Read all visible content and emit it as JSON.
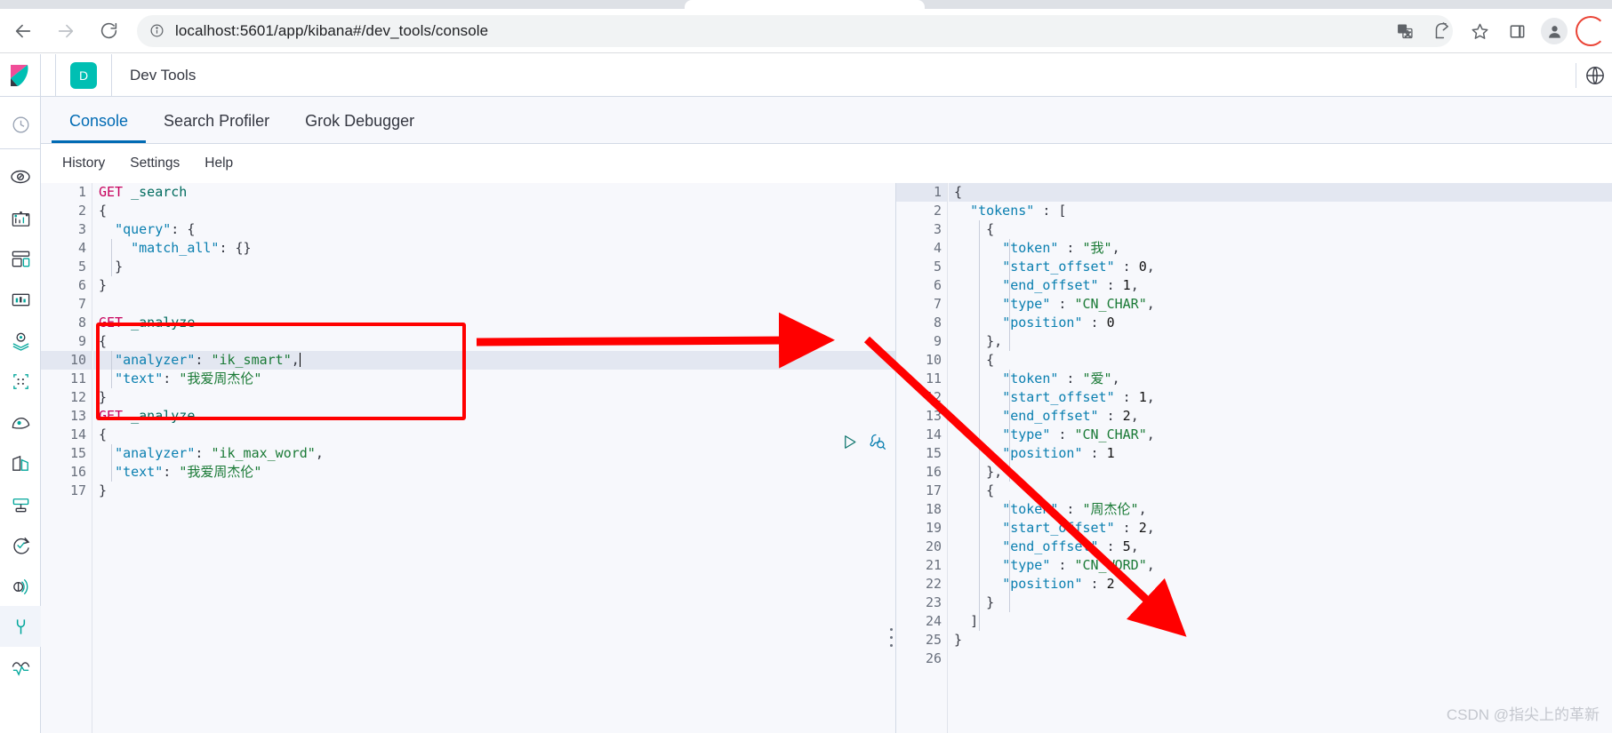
{
  "browser": {
    "url": "localhost:5601/app/kibana#/dev_tools/console",
    "back_label": "Back",
    "forward_label": "Forward",
    "reload_label": "Reload",
    "site_info_label": "View site information",
    "translate_label": "Translate this page",
    "share_label": "Share this page",
    "bookmark_label": "Bookmark this tab",
    "sidepanel_label": "Show side panel",
    "profile_label": "Profile"
  },
  "kibana": {
    "app_badge": "D",
    "app_title": "Dev Tools",
    "help_label": "Help menu",
    "tabs": [
      {
        "label": "Console",
        "active": true
      },
      {
        "label": "Search Profiler",
        "active": false
      },
      {
        "label": "Grok Debugger",
        "active": false
      }
    ],
    "console_menu": [
      {
        "label": "History"
      },
      {
        "label": "Settings"
      },
      {
        "label": "Help"
      }
    ],
    "sidebar": [
      {
        "name": "recently-viewed-icon"
      },
      {
        "name": "discover-icon"
      },
      {
        "name": "visualize-icon"
      },
      {
        "name": "dashboard-icon"
      },
      {
        "name": "canvas-icon"
      },
      {
        "name": "maps-icon"
      },
      {
        "name": "machine-learning-icon"
      },
      {
        "name": "infrastructure-icon"
      },
      {
        "name": "logs-icon"
      },
      {
        "name": "apm-icon"
      },
      {
        "name": "uptime-icon"
      },
      {
        "name": "siem-icon"
      },
      {
        "name": "dev-tools-icon"
      },
      {
        "name": "monitoring-icon"
      }
    ],
    "request_actions": {
      "play_label": "Click to send request",
      "wrench_label": "Open documentation / options"
    }
  },
  "editor": {
    "lines": [
      {
        "n": 1,
        "fold": "",
        "tokens": [
          {
            "t": "method",
            "v": "GET"
          },
          {
            "t": "plain",
            "v": " "
          },
          {
            "t": "url",
            "v": "_search"
          }
        ]
      },
      {
        "n": 2,
        "fold": "▾",
        "tokens": [
          {
            "t": "punct",
            "v": "{"
          }
        ]
      },
      {
        "n": 3,
        "fold": "▾",
        "tokens": [
          {
            "t": "plain",
            "v": "  "
          },
          {
            "t": "key",
            "v": "\"query\""
          },
          {
            "t": "punct",
            "v": ": {"
          }
        ]
      },
      {
        "n": 4,
        "fold": "",
        "tokens": [
          {
            "t": "plain",
            "v": "    "
          },
          {
            "t": "key",
            "v": "\"match_all\""
          },
          {
            "t": "punct",
            "v": ": {}"
          }
        ]
      },
      {
        "n": 5,
        "fold": "▴",
        "tokens": [
          {
            "t": "plain",
            "v": "  "
          },
          {
            "t": "punct",
            "v": "}"
          }
        ]
      },
      {
        "n": 6,
        "fold": "▴",
        "tokens": [
          {
            "t": "punct",
            "v": "}"
          }
        ]
      },
      {
        "n": 7,
        "fold": "",
        "tokens": []
      },
      {
        "n": 8,
        "fold": "",
        "tokens": [
          {
            "t": "method",
            "v": "GET"
          },
          {
            "t": "plain",
            "v": " "
          },
          {
            "t": "url",
            "v": "_analyze"
          }
        ]
      },
      {
        "n": 9,
        "fold": "▾",
        "tokens": [
          {
            "t": "punct",
            "v": "{"
          }
        ]
      },
      {
        "n": 10,
        "fold": "",
        "hl": true,
        "tokens": [
          {
            "t": "plain",
            "v": "  "
          },
          {
            "t": "key",
            "v": "\"analyzer\""
          },
          {
            "t": "punct",
            "v": ": "
          },
          {
            "t": "str",
            "v": "\"ik_smart\""
          },
          {
            "t": "punct",
            "v": ","
          },
          {
            "t": "caret",
            "v": ""
          }
        ]
      },
      {
        "n": 11,
        "fold": "",
        "tokens": [
          {
            "t": "plain",
            "v": "  "
          },
          {
            "t": "key",
            "v": "\"text\""
          },
          {
            "t": "punct",
            "v": ": "
          },
          {
            "t": "str",
            "v": "\"我爱周杰伦\""
          }
        ]
      },
      {
        "n": 12,
        "fold": "▴",
        "tokens": [
          {
            "t": "punct",
            "v": "}"
          }
        ]
      },
      {
        "n": 13,
        "fold": "",
        "tokens": [
          {
            "t": "method",
            "v": "GET"
          },
          {
            "t": "plain",
            "v": " "
          },
          {
            "t": "url",
            "v": "_analyze"
          }
        ]
      },
      {
        "n": 14,
        "fold": "▾",
        "tokens": [
          {
            "t": "punct",
            "v": "{"
          }
        ]
      },
      {
        "n": 15,
        "fold": "",
        "tokens": [
          {
            "t": "plain",
            "v": "  "
          },
          {
            "t": "key",
            "v": "\"analyzer\""
          },
          {
            "t": "punct",
            "v": ": "
          },
          {
            "t": "str",
            "v": "\"ik_max_word\""
          },
          {
            "t": "punct",
            "v": ","
          }
        ]
      },
      {
        "n": 16,
        "fold": "",
        "tokens": [
          {
            "t": "plain",
            "v": "  "
          },
          {
            "t": "key",
            "v": "\"text\""
          },
          {
            "t": "punct",
            "v": ": "
          },
          {
            "t": "str",
            "v": "\"我爱周杰伦\""
          }
        ]
      },
      {
        "n": 17,
        "fold": "▴",
        "tokens": [
          {
            "t": "punct",
            "v": "}"
          }
        ]
      }
    ]
  },
  "response": {
    "lines": [
      {
        "n": 1,
        "fold": "▾",
        "hl": true,
        "tokens": [
          {
            "t": "punct",
            "v": "{"
          }
        ]
      },
      {
        "n": 2,
        "fold": "▾",
        "tokens": [
          {
            "t": "plain",
            "v": "  "
          },
          {
            "t": "key",
            "v": "\"tokens\""
          },
          {
            "t": "punct",
            "v": " : ["
          }
        ]
      },
      {
        "n": 3,
        "fold": "▾",
        "tokens": [
          {
            "t": "plain",
            "v": "    "
          },
          {
            "t": "punct",
            "v": "{"
          }
        ]
      },
      {
        "n": 4,
        "fold": "",
        "tokens": [
          {
            "t": "plain",
            "v": "      "
          },
          {
            "t": "key",
            "v": "\"token\""
          },
          {
            "t": "punct",
            "v": " : "
          },
          {
            "t": "str",
            "v": "\"我\""
          },
          {
            "t": "punct",
            "v": ","
          }
        ]
      },
      {
        "n": 5,
        "fold": "",
        "tokens": [
          {
            "t": "plain",
            "v": "      "
          },
          {
            "t": "key",
            "v": "\"start_offset\""
          },
          {
            "t": "punct",
            "v": " : "
          },
          {
            "t": "num",
            "v": "0"
          },
          {
            "t": "punct",
            "v": ","
          }
        ]
      },
      {
        "n": 6,
        "fold": "",
        "tokens": [
          {
            "t": "plain",
            "v": "      "
          },
          {
            "t": "key",
            "v": "\"end_offset\""
          },
          {
            "t": "punct",
            "v": " : "
          },
          {
            "t": "num",
            "v": "1"
          },
          {
            "t": "punct",
            "v": ","
          }
        ]
      },
      {
        "n": 7,
        "fold": "",
        "tokens": [
          {
            "t": "plain",
            "v": "      "
          },
          {
            "t": "key",
            "v": "\"type\""
          },
          {
            "t": "punct",
            "v": " : "
          },
          {
            "t": "str",
            "v": "\"CN_CHAR\""
          },
          {
            "t": "punct",
            "v": ","
          }
        ]
      },
      {
        "n": 8,
        "fold": "",
        "tokens": [
          {
            "t": "plain",
            "v": "      "
          },
          {
            "t": "key",
            "v": "\"position\""
          },
          {
            "t": "punct",
            "v": " : "
          },
          {
            "t": "num",
            "v": "0"
          }
        ]
      },
      {
        "n": 9,
        "fold": "▴",
        "tokens": [
          {
            "t": "plain",
            "v": "    "
          },
          {
            "t": "punct",
            "v": "},"
          }
        ]
      },
      {
        "n": 10,
        "fold": "▾",
        "tokens": [
          {
            "t": "plain",
            "v": "    "
          },
          {
            "t": "punct",
            "v": "{"
          }
        ]
      },
      {
        "n": 11,
        "fold": "",
        "tokens": [
          {
            "t": "plain",
            "v": "      "
          },
          {
            "t": "key",
            "v": "\"token\""
          },
          {
            "t": "punct",
            "v": " : "
          },
          {
            "t": "str",
            "v": "\"爱\""
          },
          {
            "t": "punct",
            "v": ","
          }
        ]
      },
      {
        "n": 12,
        "fold": "",
        "tokens": [
          {
            "t": "plain",
            "v": "      "
          },
          {
            "t": "key",
            "v": "\"start_offset\""
          },
          {
            "t": "punct",
            "v": " : "
          },
          {
            "t": "num",
            "v": "1"
          },
          {
            "t": "punct",
            "v": ","
          }
        ]
      },
      {
        "n": 13,
        "fold": "",
        "tokens": [
          {
            "t": "plain",
            "v": "      "
          },
          {
            "t": "key",
            "v": "\"end_offset\""
          },
          {
            "t": "punct",
            "v": " : "
          },
          {
            "t": "num",
            "v": "2"
          },
          {
            "t": "punct",
            "v": ","
          }
        ]
      },
      {
        "n": 14,
        "fold": "",
        "tokens": [
          {
            "t": "plain",
            "v": "      "
          },
          {
            "t": "key",
            "v": "\"type\""
          },
          {
            "t": "punct",
            "v": " : "
          },
          {
            "t": "str",
            "v": "\"CN_CHAR\""
          },
          {
            "t": "punct",
            "v": ","
          }
        ]
      },
      {
        "n": 15,
        "fold": "",
        "tokens": [
          {
            "t": "plain",
            "v": "      "
          },
          {
            "t": "key",
            "v": "\"position\""
          },
          {
            "t": "punct",
            "v": " : "
          },
          {
            "t": "num",
            "v": "1"
          }
        ]
      },
      {
        "n": 16,
        "fold": "▴",
        "tokens": [
          {
            "t": "plain",
            "v": "    "
          },
          {
            "t": "punct",
            "v": "},"
          }
        ]
      },
      {
        "n": 17,
        "fold": "▾",
        "tokens": [
          {
            "t": "plain",
            "v": "    "
          },
          {
            "t": "punct",
            "v": "{"
          }
        ]
      },
      {
        "n": 18,
        "fold": "",
        "tokens": [
          {
            "t": "plain",
            "v": "      "
          },
          {
            "t": "key",
            "v": "\"token\""
          },
          {
            "t": "punct",
            "v": " : "
          },
          {
            "t": "str",
            "v": "\"周杰伦\""
          },
          {
            "t": "punct",
            "v": ","
          }
        ]
      },
      {
        "n": 19,
        "fold": "",
        "tokens": [
          {
            "t": "plain",
            "v": "      "
          },
          {
            "t": "key",
            "v": "\"start_offset\""
          },
          {
            "t": "punct",
            "v": " : "
          },
          {
            "t": "num",
            "v": "2"
          },
          {
            "t": "punct",
            "v": ","
          }
        ]
      },
      {
        "n": 20,
        "fold": "",
        "tokens": [
          {
            "t": "plain",
            "v": "      "
          },
          {
            "t": "key",
            "v": "\"end_offset\""
          },
          {
            "t": "punct",
            "v": " : "
          },
          {
            "t": "num",
            "v": "5"
          },
          {
            "t": "punct",
            "v": ","
          }
        ]
      },
      {
        "n": 21,
        "fold": "",
        "tokens": [
          {
            "t": "plain",
            "v": "      "
          },
          {
            "t": "key",
            "v": "\"type\""
          },
          {
            "t": "punct",
            "v": " : "
          },
          {
            "t": "str",
            "v": "\"CN_WORD\""
          },
          {
            "t": "punct",
            "v": ","
          }
        ]
      },
      {
        "n": 22,
        "fold": "",
        "tokens": [
          {
            "t": "plain",
            "v": "      "
          },
          {
            "t": "key",
            "v": "\"position\""
          },
          {
            "t": "punct",
            "v": " : "
          },
          {
            "t": "num",
            "v": "2"
          }
        ]
      },
      {
        "n": 23,
        "fold": "▴",
        "tokens": [
          {
            "t": "plain",
            "v": "    "
          },
          {
            "t": "punct",
            "v": "}"
          }
        ]
      },
      {
        "n": 24,
        "fold": "▴",
        "tokens": [
          {
            "t": "plain",
            "v": "  "
          },
          {
            "t": "punct",
            "v": "]"
          }
        ]
      },
      {
        "n": 25,
        "fold": "▴",
        "tokens": [
          {
            "t": "punct",
            "v": "}"
          }
        ]
      },
      {
        "n": 26,
        "fold": "",
        "tokens": []
      }
    ]
  },
  "annotations": {
    "highlight_box_label": "red-highlight-box-around-ik-smart-request",
    "arrow1_label": "arrow-pointing-to-run-button",
    "arrow2_label": "arrow-pointing-to-response-tokens",
    "color": "#ff0000"
  },
  "watermark": {
    "text": "CSDN @指尖上的革新"
  }
}
